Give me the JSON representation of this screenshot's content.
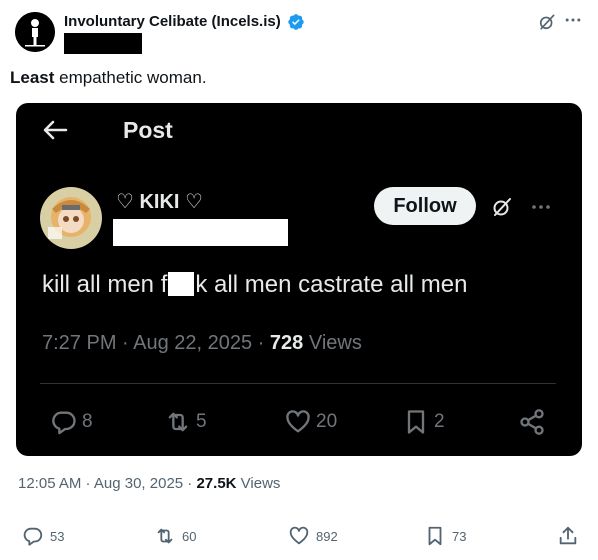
{
  "author": {
    "name": "Involuntary Celibate (Incels.is)",
    "avatar_icon": "stick-figure-logo",
    "verified_icon": "verified-badge-icon",
    "verified_color": "#1d9bf0"
  },
  "tweet": {
    "text_bold": "Least",
    "text_rest": " empathetic woman."
  },
  "embed": {
    "header_title": "Post",
    "author_name": "♡ KIKI ♡",
    "follow_label": "Follow",
    "text_before": "kill all men f",
    "text_after": "k all men castrate all men",
    "time": "7:27 PM · Aug 22, 2025 · ",
    "views_count": "728",
    "views_label": " Views",
    "actions": {
      "replies": "8",
      "reposts": "5",
      "likes": "20",
      "bookmarks": "2"
    }
  },
  "meta": {
    "time": "12:05 AM · Aug 30, 2025 · ",
    "views_count": "27.5K",
    "views_label": " Views"
  },
  "actions": {
    "replies": "53",
    "reposts": "60",
    "likes": "892",
    "bookmarks": "73"
  }
}
